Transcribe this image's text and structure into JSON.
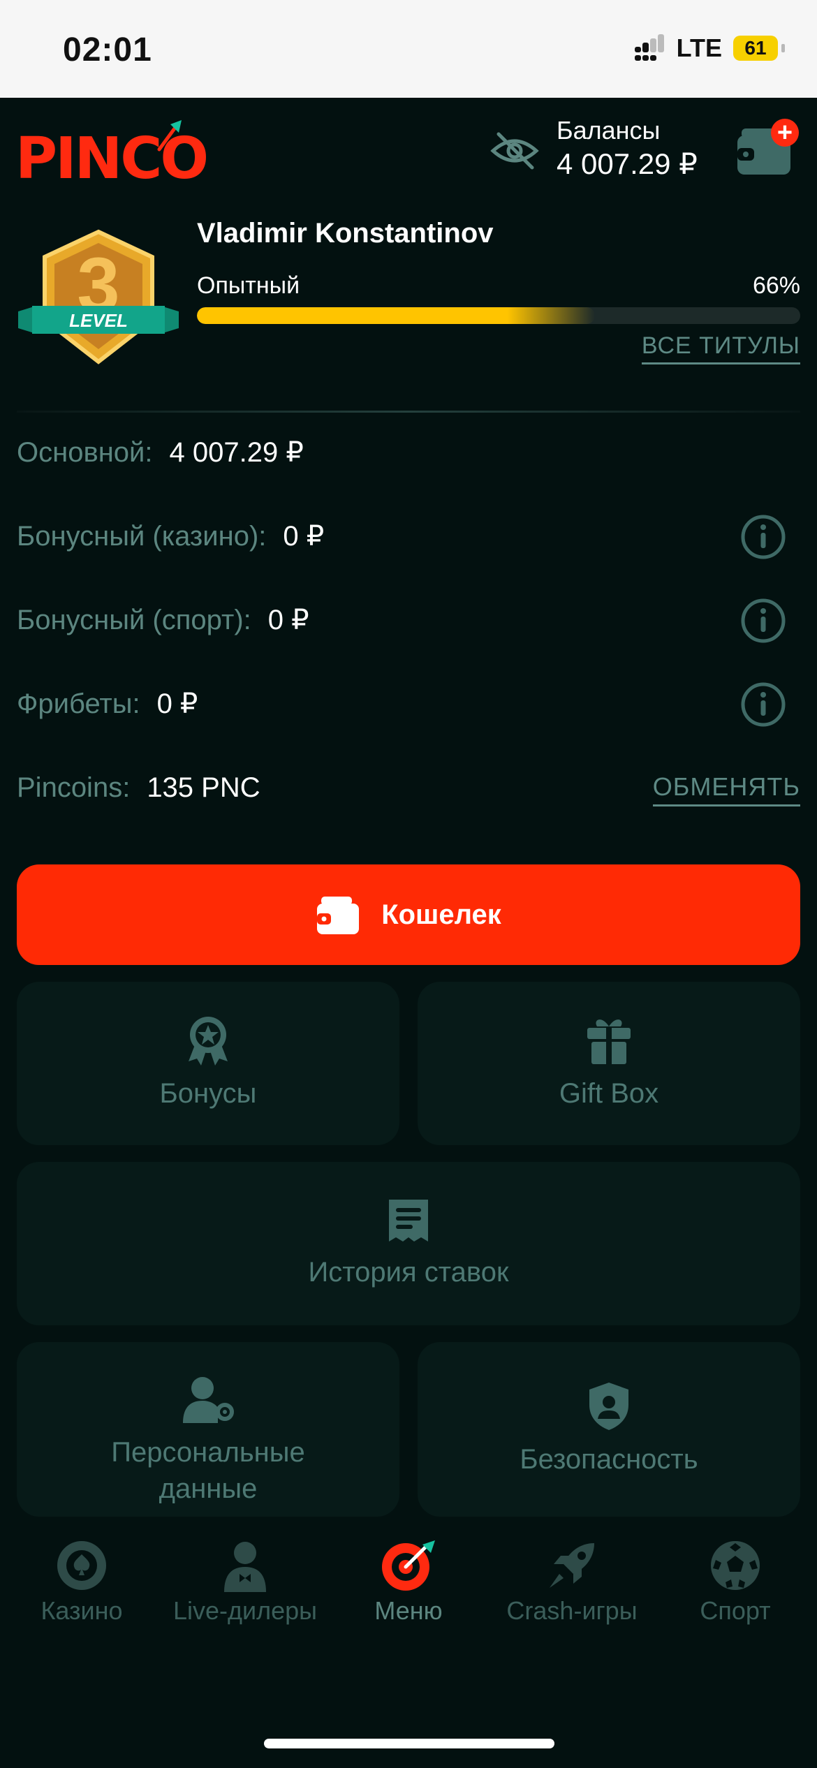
{
  "status_bar": {
    "time": "02:01",
    "network": "LTE",
    "battery": "61"
  },
  "header": {
    "logo_text": "PINCO",
    "balance_label": "Балансы",
    "balance_value": "4 007.29 ₽"
  },
  "profile": {
    "level_number": "3",
    "level_word": "LEVEL",
    "name": "Vladimir Konstantinov",
    "rank": "Опытный",
    "progress_percent_text": "66%",
    "progress_value": 66,
    "all_titles_link": "ВСЕ ТИТУЛЫ"
  },
  "balances": [
    {
      "label": "Основной:",
      "value": "4 007.29 ₽"
    },
    {
      "label": "Бонусный (казино):",
      "value": "0 ₽"
    },
    {
      "label": "Бонусный (спорт):",
      "value": "0 ₽"
    },
    {
      "label": "Фрибеты:",
      "value": "0 ₽"
    },
    {
      "label": "Pincoins:",
      "value": "135 PNC"
    }
  ],
  "exchange_link": "ОБМЕНЯТЬ",
  "wallet_button": "Кошелек",
  "tiles": {
    "bonuses": "Бонусы",
    "gift_box": "Gift Box",
    "bet_history": "История ставок",
    "personal_data_line1": "Персональные",
    "personal_data_line2": "данные",
    "security": "Безопасность"
  },
  "bottom_nav": [
    {
      "label": "Казино",
      "icon": "casino-chip-icon"
    },
    {
      "label": "Live-дилеры",
      "icon": "dealer-icon"
    },
    {
      "label": "Меню",
      "icon": "target-icon"
    },
    {
      "label": "Crash-игры",
      "icon": "rocket-icon"
    },
    {
      "label": "Спорт",
      "icon": "soccer-ball-icon"
    }
  ],
  "colors": {
    "background": "#031110",
    "accent_red": "#ff2a05",
    "progress_yellow": "#ffc400",
    "muted_teal": "#5c8680",
    "tile_bg": "#071a18"
  }
}
